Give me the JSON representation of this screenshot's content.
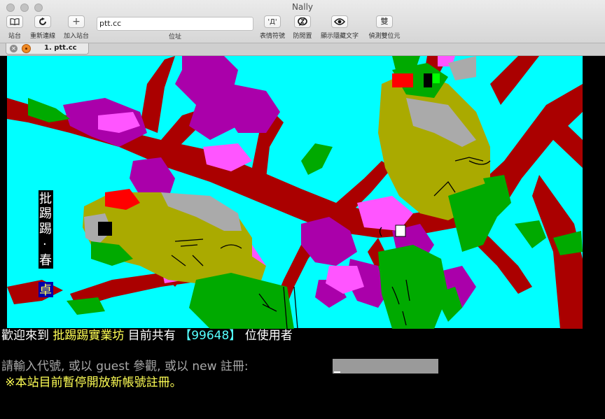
{
  "window": {
    "title": "Nally"
  },
  "toolbar": {
    "sites_label": "站台",
    "reconnect_label": "重新連線",
    "add_site_label": "加入站台",
    "address_label": "位址",
    "url_value": "ptt.cc",
    "emoticons_label": "表情符號",
    "anti_idle_label": "防閒置",
    "show_hidden_label": "顯示隱藏文字",
    "detect_double_byte_label": "偵測雙位元",
    "double_byte_glyph": "雙",
    "add_glyph": "+"
  },
  "tab": {
    "label": "1. ptt.cc"
  },
  "art": {
    "vertical_title": [
      "批",
      "踢",
      "踢",
      "·",
      "春"
    ],
    "badge": "卓"
  },
  "terminal": {
    "welcome_prefix": "歡迎來到 ",
    "site_name": "批踢踢實業坊",
    "online_prefix": " 目前共有 ",
    "online_count": "【99648】",
    "online_suffix": " 位使用者",
    "login_prompt": "請輸入代號, 或以 guest 參觀, 或以 new 註冊: ",
    "notice": " ※本站目前暫停開放新帳號註冊。"
  },
  "colors": {
    "sky": "#00ffff",
    "branch": "#aa0000",
    "blossom_magenta": "#aa00aa",
    "blossom_pink": "#ff55ff",
    "bird_olive": "#aaaa00",
    "bird_gray": "#aaaaaa",
    "leaf_green": "#00aa00",
    "highlight_yellow": "#ffff55",
    "count_cyan": "#55ffff",
    "prompt_gray": "#aaaaaa"
  }
}
